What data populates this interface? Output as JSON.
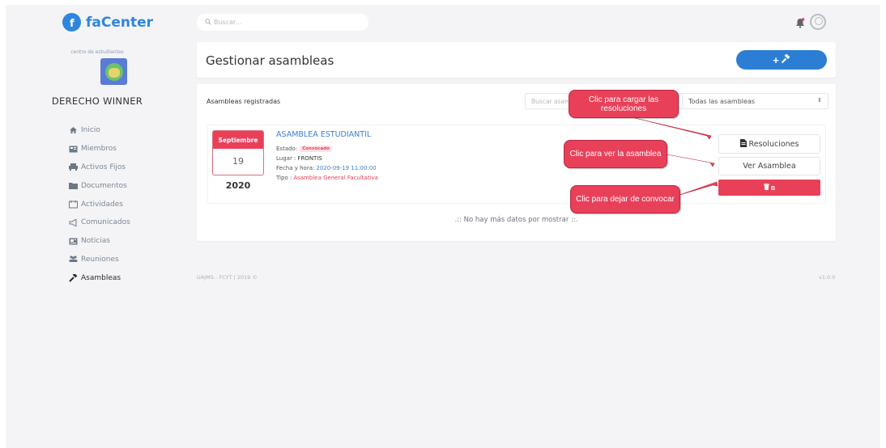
{
  "brand": {
    "name": "faCenter",
    "color": "#2e86de"
  },
  "sidebar": {
    "org_subtitle": "centro de estudiantes",
    "org_name": "DERECHO WINNER",
    "items": [
      {
        "label": "Inicio",
        "icon": "home-icon"
      },
      {
        "label": "Miembros",
        "icon": "members-icon"
      },
      {
        "label": "Activos Fijos",
        "icon": "assets-icon"
      },
      {
        "label": "Documentos",
        "icon": "folder-icon"
      },
      {
        "label": "Actividades",
        "icon": "activities-icon"
      },
      {
        "label": "Comunicados",
        "icon": "megaphone-icon"
      },
      {
        "label": "Noticias",
        "icon": "news-icon"
      },
      {
        "label": "Reuniones",
        "icon": "meeting-icon"
      },
      {
        "label": "Asambleas",
        "icon": "gavel-icon",
        "active": true
      }
    ]
  },
  "topbar": {
    "search_placeholder": "Buscar..."
  },
  "header": {
    "title": "Gestionar asambleas",
    "add_button_label": "+"
  },
  "list": {
    "label": "Asambleas registradas",
    "filter_placeholder": "Buscar asamblea",
    "filter_select": "Todas las asambleas",
    "items": [
      {
        "month": "Septiembre",
        "day": "19",
        "year": "2020",
        "title": "ASAMBLEA ESTUDIANTIL",
        "estado_label": "Estado:",
        "estado_value": "Convocado",
        "lugar_label": "Lugar :",
        "lugar_value": "FRONTIS",
        "fecha_label": "Fecha y hora:",
        "fecha_value": "2020-09-19 11:00:00",
        "tipo_label": "Tipo :",
        "tipo_value": "Asamblea General Facultativa",
        "btn_resoluciones": "Resoluciones",
        "btn_ver": "Ver Asamblea",
        "btn_delete": "B"
      }
    ],
    "no_more": ".:: No hay más datos por mostrar ::."
  },
  "footer": {
    "left": "UAJMS - FCYT | 2019 ©",
    "right": "v1.0.0"
  },
  "callouts": {
    "c1": "Clic para cargar las resoluciones",
    "c2": "Clic para ver la asamblea",
    "c3": "Clic para dejar de convocar"
  },
  "colors": {
    "accent": "#2b7ed4",
    "danger": "#e9405a",
    "background": "#f4f4f6"
  }
}
